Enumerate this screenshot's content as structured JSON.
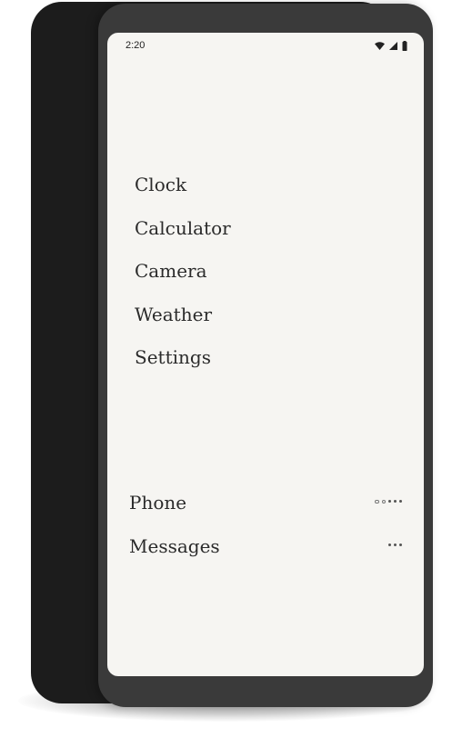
{
  "status_bar": {
    "time": "2:20",
    "icons": [
      "wifi-icon",
      "cell-signal-icon",
      "battery-icon"
    ]
  },
  "apps": [
    {
      "label": "Clock"
    },
    {
      "label": "Calculator"
    },
    {
      "label": "Camera"
    },
    {
      "label": "Weather"
    },
    {
      "label": "Settings"
    }
  ],
  "favorites": [
    {
      "label": "Phone",
      "indicator_icon": "notification-dots-icon",
      "filled_dots": 3,
      "hollow_dots": 2
    },
    {
      "label": "Messages",
      "indicator_icon": "notification-dots-icon",
      "filled_dots": 3,
      "hollow_dots": 0
    }
  ],
  "colors": {
    "screen_background": "#f6f5f2",
    "text": "#2b2b2b",
    "phone_frame": "#3a3a3a",
    "phone_back": "#1c1c1c"
  }
}
